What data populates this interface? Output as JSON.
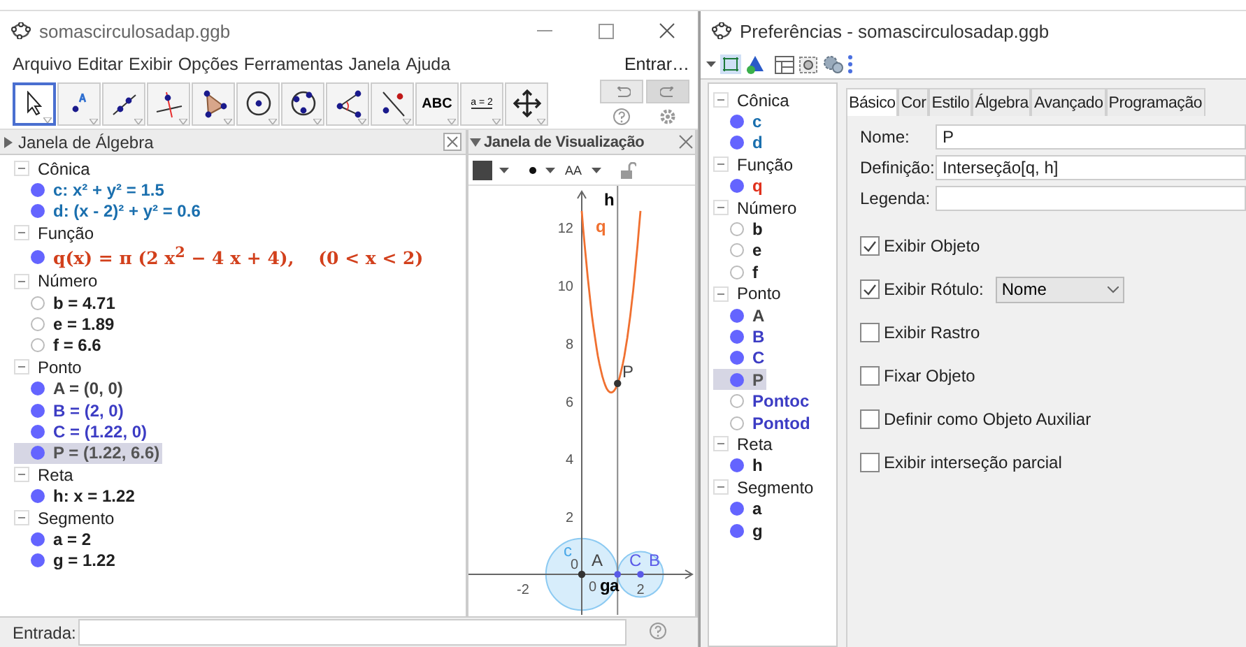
{
  "main_window": {
    "title": "somascirculosadap.ggb",
    "menu": [
      "Arquivo",
      "Editar",
      "Exibir",
      "Opções",
      "Ferramentas",
      "Janela",
      "Ajuda"
    ],
    "login": "Entrar…",
    "tools": [
      {
        "kind": "move",
        "selected": true
      },
      {
        "kind": "point",
        "selected": false
      },
      {
        "kind": "line",
        "selected": false
      },
      {
        "kind": "perpendicular",
        "selected": false
      },
      {
        "kind": "polygon",
        "selected": false
      },
      {
        "kind": "circle",
        "selected": false
      },
      {
        "kind": "circle3",
        "selected": false
      },
      {
        "kind": "angle",
        "selected": false
      },
      {
        "kind": "reflect",
        "selected": false
      },
      {
        "kind": "text",
        "label": "ABC",
        "selected": false
      },
      {
        "kind": "slider",
        "label": "a = 2",
        "selected": false
      },
      {
        "kind": "pan",
        "selected": false
      }
    ]
  },
  "algebra_view": {
    "title": "Janela de Álgebra",
    "groups": [
      {
        "label": "Cônica",
        "expanded": true,
        "items": [
          {
            "text": "c: x² + y² = 1.5",
            "visible": true,
            "color": "#1a6fae",
            "selected": false
          },
          {
            "text": "d: (x - 2)² + y² = 0.6",
            "visible": true,
            "color": "#1a6fae",
            "selected": false
          }
        ]
      },
      {
        "label": "Função",
        "expanded": true,
        "items": [
          {
            "text": "q(x) = π (2 x$^{2}$ − 4 x + 4),    (0 < x < 2)",
            "visible": true,
            "color": "#d2401c",
            "selected": false
          }
        ]
      },
      {
        "label": "Número",
        "expanded": true,
        "items": [
          {
            "text": "b = 4.71",
            "visible": false,
            "color": "#202020",
            "selected": false
          },
          {
            "text": "e = 1.89",
            "visible": false,
            "color": "#202020",
            "selected": false
          },
          {
            "text": "f = 6.6",
            "visible": false,
            "color": "#202020",
            "selected": false
          }
        ]
      },
      {
        "label": "Ponto",
        "expanded": true,
        "items": [
          {
            "text": "A = (0, 0)",
            "visible": true,
            "color": "#444444",
            "selected": false
          },
          {
            "text": "B = (2, 0)",
            "visible": true,
            "color": "#3c3cc4",
            "selected": false
          },
          {
            "text": "C = (1.22, 0)",
            "visible": true,
            "color": "#3c3cc4",
            "selected": false
          },
          {
            "text": "P = (1.22, 6.6)",
            "visible": true,
            "color": "#555555",
            "selected": true
          }
        ]
      },
      {
        "label": "Reta",
        "expanded": true,
        "items": [
          {
            "text": "h: x = 1.22",
            "visible": true,
            "color": "#202020",
            "selected": false
          }
        ]
      },
      {
        "label": "Segmento",
        "expanded": true,
        "items": [
          {
            "text": "a = 2",
            "visible": true,
            "color": "#202020",
            "selected": false
          },
          {
            "text": "g = 1.22",
            "visible": true,
            "color": "#202020",
            "selected": false
          }
        ]
      }
    ]
  },
  "graphics_view": {
    "title": "Janela de Visualização",
    "font_button": "AA",
    "y_ticks": [
      "12",
      "10",
      "8",
      "6",
      "4",
      "2"
    ],
    "x_ticks": [
      "-2",
      "2"
    ],
    "labels": [
      {
        "text": "h",
        "color": "#000000"
      },
      {
        "text": "q",
        "color": "#f07030"
      },
      {
        "text": "P",
        "color": "#444444"
      },
      {
        "text": "c",
        "color": "#4aa8e8"
      },
      {
        "text": "0",
        "color": "#555555"
      },
      {
        "text": "A",
        "color": "#444444"
      },
      {
        "text": "0",
        "color": "#555555"
      },
      {
        "text": "g",
        "color": "#000000"
      },
      {
        "text": "a",
        "color": "#000000"
      },
      {
        "text": "C",
        "color": "#5a5ae8"
      },
      {
        "text": "B",
        "color": "#5a5ae8"
      }
    ]
  },
  "input_bar": {
    "label": "Entrada:"
  },
  "preferences": {
    "title": "Preferências - somascirculosadap.ggb",
    "tree": [
      {
        "label": "Cônica",
        "expanded": true,
        "items": [
          {
            "text": "c",
            "visible": true,
            "color": "#1a6fae",
            "selected": false
          },
          {
            "text": "d",
            "visible": true,
            "color": "#1a6fae",
            "selected": false
          }
        ]
      },
      {
        "label": "Função",
        "expanded": true,
        "items": [
          {
            "text": "q",
            "visible": true,
            "color": "#e0301c",
            "selected": false
          }
        ]
      },
      {
        "label": "Número",
        "expanded": true,
        "items": [
          {
            "text": "b",
            "visible": false,
            "color": "#202020",
            "selected": false
          },
          {
            "text": "e",
            "visible": false,
            "color": "#202020",
            "selected": false
          },
          {
            "text": "f",
            "visible": false,
            "color": "#202020",
            "selected": false
          }
        ]
      },
      {
        "label": "Ponto",
        "expanded": true,
        "items": [
          {
            "text": "A",
            "visible": true,
            "color": "#444444",
            "selected": false
          },
          {
            "text": "B",
            "visible": true,
            "color": "#3c3cc4",
            "selected": false
          },
          {
            "text": "C",
            "visible": true,
            "color": "#3c3cc4",
            "selected": false
          },
          {
            "text": "P",
            "visible": true,
            "color": "#555555",
            "selected": true
          },
          {
            "text": "Pontoc",
            "visible": false,
            "color": "#3c3cc4",
            "selected": false
          },
          {
            "text": "Pontod",
            "visible": false,
            "color": "#3c3cc4",
            "selected": false
          }
        ]
      },
      {
        "label": "Reta",
        "expanded": true,
        "items": [
          {
            "text": "h",
            "visible": true,
            "color": "#202020",
            "selected": false
          }
        ]
      },
      {
        "label": "Segmento",
        "expanded": true,
        "items": [
          {
            "text": "a",
            "visible": true,
            "color": "#202020",
            "selected": false
          },
          {
            "text": "g",
            "visible": true,
            "color": "#202020",
            "selected": false
          }
        ]
      }
    ],
    "tabs": [
      {
        "label": "Básico",
        "selected": true
      },
      {
        "label": "Cor",
        "selected": false
      },
      {
        "label": "Estilo",
        "selected": false
      },
      {
        "label": "Álgebra",
        "selected": false
      },
      {
        "label": "Avançado",
        "selected": false
      },
      {
        "label": "Programação",
        "selected": false
      }
    ],
    "fields": [
      {
        "label": "Nome:",
        "value": "P"
      },
      {
        "label": "Definição:",
        "value": "Interseção[q, h]"
      },
      {
        "label": "Legenda:"
      }
    ],
    "checkboxes": [
      {
        "label": "Exibir Objeto",
        "checked": true
      },
      {
        "label": "Exibir Rótulo:",
        "checked": true,
        "dropdown": "Nome"
      },
      {
        "label": "Exibir Rastro",
        "checked": false
      },
      {
        "label": "Fixar Objeto",
        "checked": false
      },
      {
        "label": "Definir como Objeto Auxiliar",
        "checked": false
      },
      {
        "label": "Exibir interseção parcial",
        "checked": false
      }
    ]
  }
}
